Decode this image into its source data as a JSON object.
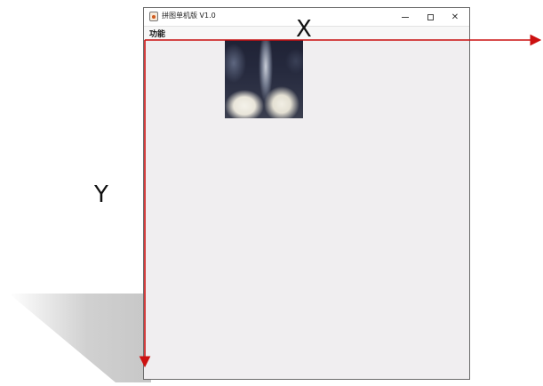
{
  "window": {
    "title": "拼图单机版 V1.0",
    "icon": "java-cup-icon",
    "controls": {
      "minimize": "minimize-icon",
      "maximize": "maximize-icon",
      "close": "close-icon",
      "close_glyph": "✕"
    }
  },
  "menubar": {
    "items": [
      {
        "label": "功能"
      }
    ]
  },
  "annotations": {
    "x_label": "X",
    "y_label": "Y",
    "axis_color": "#cc1111"
  }
}
